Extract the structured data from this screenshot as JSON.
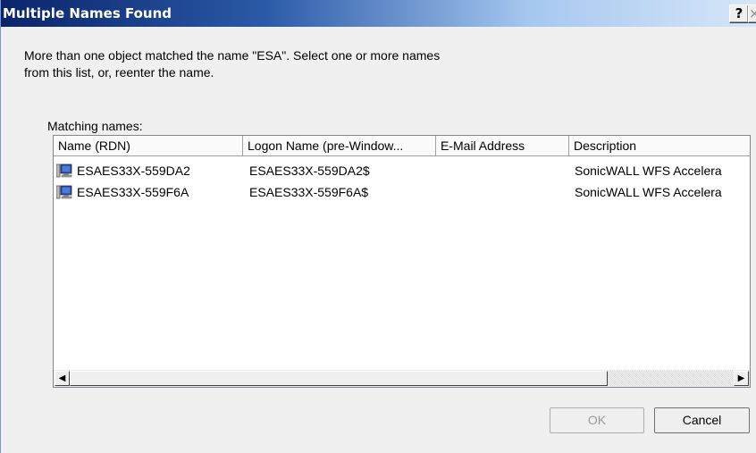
{
  "window": {
    "title": "Multiple Names Found",
    "help_glyph": "?",
    "close_glyph": "×"
  },
  "message": {
    "line1": "More than one object matched the name \"ESA\". Select one or more names",
    "line2": "from this list, or, reenter the name."
  },
  "list": {
    "label": "Matching names:",
    "columns": [
      "Name (RDN)",
      "Logon Name (pre-Window...",
      "E-Mail Address",
      "Description"
    ],
    "rows": [
      {
        "icon": "computer-icon",
        "name": "ESAES33X-559DA2",
        "logon": "ESAES33X-559DA2$",
        "email": "",
        "description": "SonicWALL WFS Accelera"
      },
      {
        "icon": "computer-icon",
        "name": "ESAES33X-559F6A",
        "logon": "ESAES33X-559F6A$",
        "email": "",
        "description": "SonicWALL WFS Accelera"
      }
    ]
  },
  "scrollbar": {
    "left_arrow": "◀",
    "right_arrow": "▶"
  },
  "buttons": {
    "ok": "OK",
    "cancel": "Cancel"
  }
}
